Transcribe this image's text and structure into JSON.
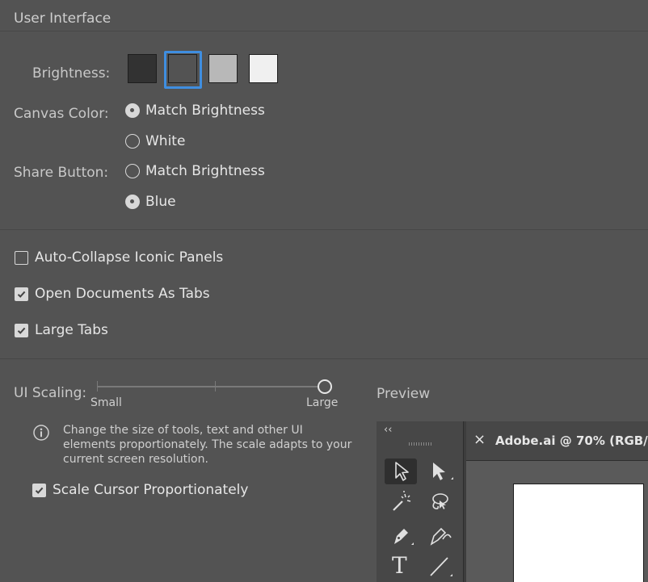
{
  "section": {
    "title": "User Interface"
  },
  "brightness": {
    "label": "Brightness:",
    "swatches": [
      {
        "name": "dark",
        "color": "#323232"
      },
      {
        "name": "medium-dark",
        "color": "#535353",
        "selected": true
      },
      {
        "name": "medium-light",
        "color": "#b8b8b8"
      },
      {
        "name": "light",
        "color": "#f0f0f0"
      }
    ],
    "selected_color": "#3f8ee0"
  },
  "canvas_color": {
    "label": "Canvas Color:",
    "options": [
      {
        "label": "Match Brightness",
        "selected": true
      },
      {
        "label": "White",
        "selected": false
      }
    ]
  },
  "share_button": {
    "label": "Share Button:",
    "options": [
      {
        "label": "Match Brightness",
        "selected": false
      },
      {
        "label": "Blue",
        "selected": true
      }
    ]
  },
  "checkboxes": {
    "auto_collapse": {
      "label": "Auto-Collapse Iconic Panels",
      "checked": false
    },
    "open_as_tabs": {
      "label": "Open Documents As Tabs",
      "checked": true
    },
    "large_tabs": {
      "label": "Large Tabs",
      "checked": true
    }
  },
  "ui_scaling": {
    "label": "UI Scaling:",
    "min_label": "Small",
    "max_label": "Large",
    "value": 1.0,
    "info_icon": "info-icon",
    "info_text": "Change the size of tools, text and other UI elements proportionately. The scale adapts to your current screen resolution."
  },
  "scale_cursor": {
    "label": "Scale Cursor Proportionately",
    "checked": true
  },
  "preview": {
    "label": "Preview",
    "collapse_glyph": "‹‹",
    "doc_tab_title": "Adobe.ai @ 70% (RGB/",
    "close_glyph": "×",
    "tools": [
      "selection-tool-icon",
      "direct-selection-tool-icon",
      "magic-wand-tool-icon",
      "lasso-tool-icon",
      "pen-tool-icon",
      "curvature-tool-icon",
      "type-tool-icon",
      "line-tool-icon"
    ],
    "type_glyph": "T"
  }
}
